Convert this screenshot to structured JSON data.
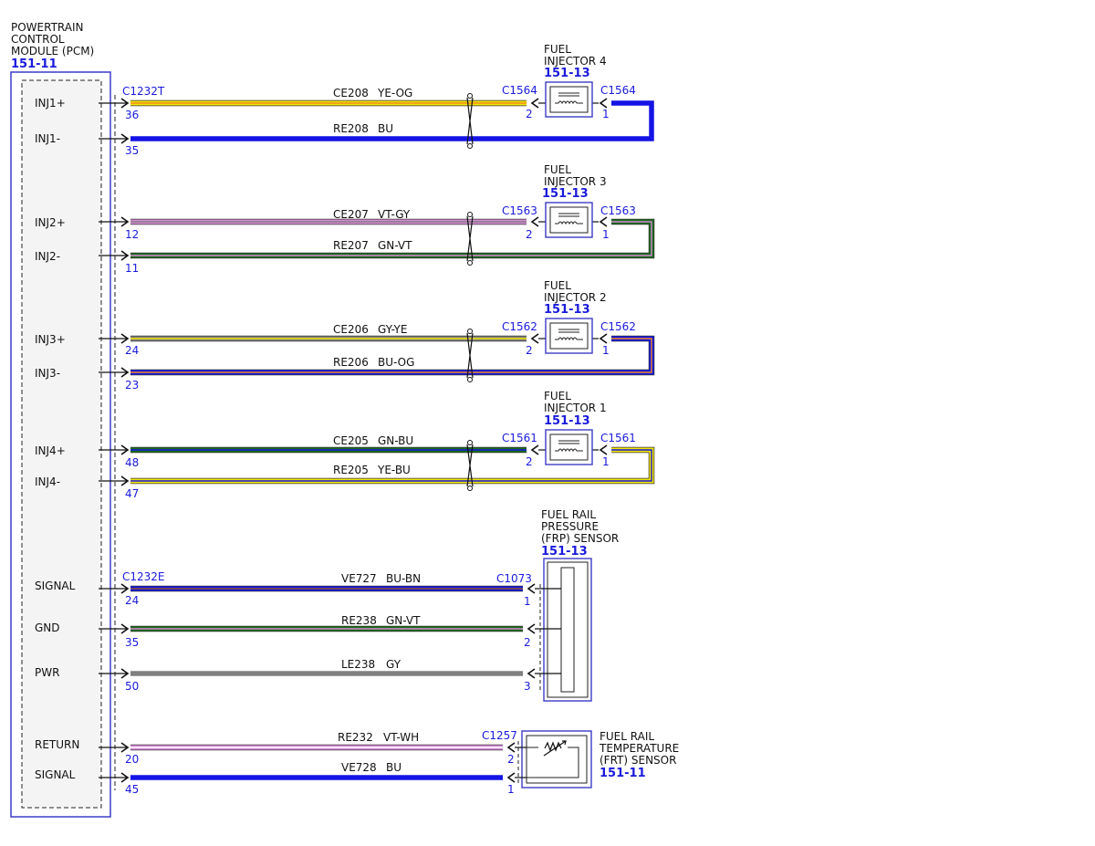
{
  "pcm": {
    "title_lines": [
      "POWERTRAIN",
      "CONTROL",
      "MODULE (PCM)"
    ],
    "code": "151-11",
    "connector_t": "C1232T",
    "connector_e": "C1232E"
  },
  "colors": {
    "YE": "#f2e600",
    "OG": "#f28c1e",
    "BU": "#1414e6",
    "VT": "#d88ad8",
    "GY": "#808080",
    "GN": "#1a6b1a",
    "BN": "#8b5a2b",
    "WH": "#ffffff",
    "outline": "#3c3cc8"
  },
  "injectors": [
    {
      "name_lines": [
        "FUEL",
        "INJECTOR 4"
      ],
      "code": "151-13",
      "conn": "C1564",
      "pin_a": "2",
      "pin_b": "1",
      "circuits": [
        {
          "pcm_label": "INJ1+",
          "pcm_pin": "36",
          "circuit": "CE208",
          "color": "YE-OG"
        },
        {
          "pcm_label": "INJ1-",
          "pcm_pin": "35",
          "circuit": "RE208",
          "color": "BU"
        }
      ]
    },
    {
      "name_lines": [
        "FUEL",
        "INJECTOR 3"
      ],
      "code": "151-13",
      "conn": "C1563",
      "pin_a": "2",
      "pin_b": "1",
      "circuits": [
        {
          "pcm_label": "INJ2+",
          "pcm_pin": "12",
          "circuit": "CE207",
          "color": "VT-GY"
        },
        {
          "pcm_label": "INJ2-",
          "pcm_pin": "11",
          "circuit": "RE207",
          "color": "GN-VT"
        }
      ]
    },
    {
      "name_lines": [
        "FUEL",
        "INJECTOR 2"
      ],
      "code": "151-13",
      "conn": "C1562",
      "pin_a": "2",
      "pin_b": "1",
      "circuits": [
        {
          "pcm_label": "INJ3+",
          "pcm_pin": "24",
          "circuit": "CE206",
          "color": "GY-YE"
        },
        {
          "pcm_label": "INJ3-",
          "pcm_pin": "23",
          "circuit": "RE206",
          "color": "BU-OG"
        }
      ]
    },
    {
      "name_lines": [
        "FUEL",
        "INJECTOR 1"
      ],
      "code": "151-13",
      "conn": "C1561",
      "pin_a": "2",
      "pin_b": "1",
      "circuits": [
        {
          "pcm_label": "INJ4+",
          "pcm_pin": "48",
          "circuit": "CE205",
          "color": "GN-BU"
        },
        {
          "pcm_label": "INJ4-",
          "pcm_pin": "47",
          "circuit": "RE205",
          "color": "YE-BU"
        }
      ]
    }
  ],
  "frp": {
    "name_lines": [
      "FUEL RAIL",
      "PRESSURE",
      "(FRP) SENSOR"
    ],
    "code": "151-13",
    "conn": "C1073",
    "circuits": [
      {
        "pcm_label": "SIGNAL",
        "pcm_pin": "24",
        "circuit": "VE727",
        "color": "BU-BN",
        "sensor_pin": "1"
      },
      {
        "pcm_label": "GND",
        "pcm_pin": "35",
        "circuit": "RE238",
        "color": "GN-VT",
        "sensor_pin": "2"
      },
      {
        "pcm_label": "PWR",
        "pcm_pin": "50",
        "circuit": "LE238",
        "color": "GY",
        "sensor_pin": "3"
      }
    ]
  },
  "frt": {
    "name_lines": [
      "FUEL RAIL",
      "TEMPERATURE",
      "(FRT) SENSOR"
    ],
    "code": "151-11",
    "conn": "C1257",
    "circuits": [
      {
        "pcm_label": "RETURN",
        "pcm_pin": "20",
        "circuit": "RE232",
        "color": "VT-WH",
        "sensor_pin": "2"
      },
      {
        "pcm_label": "SIGNAL",
        "pcm_pin": "45",
        "circuit": "VE728",
        "color": "BU",
        "sensor_pin": "1"
      }
    ]
  }
}
